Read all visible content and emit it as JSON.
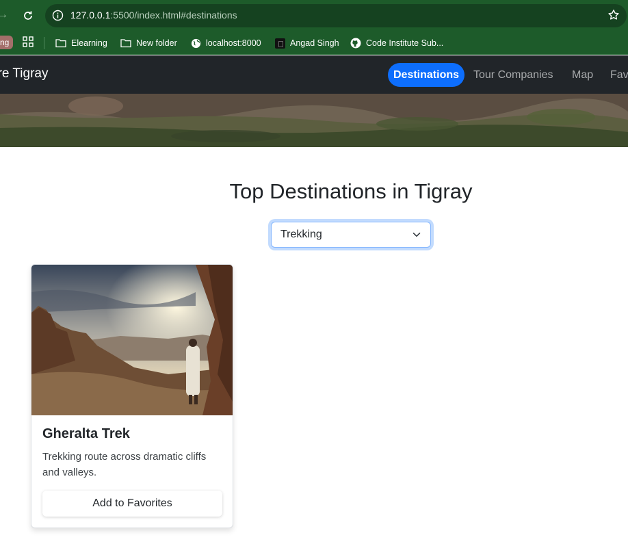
{
  "browser": {
    "url_host": "127.0.0.1",
    "url_rest": ":5500/index.html#destinations",
    "bookmarks": {
      "pill": "ng",
      "items": [
        "Elearning",
        "New folder",
        "localhost:8000",
        "Angad Singh",
        "Code Institute Sub..."
      ]
    }
  },
  "navbar": {
    "brand": "ore Tigray",
    "items": [
      "Destinations",
      "Tour Companies",
      "Map",
      "Fav"
    ],
    "active_color": "#0d6efd"
  },
  "main": {
    "heading": "Top Destinations in Tigray",
    "filter": {
      "selected": "Trekking"
    }
  },
  "cards": [
    {
      "title": "Gheralta Trek",
      "text": "Trekking route across dramatic cliffs and valleys.",
      "button": "Add to Favorites"
    }
  ]
}
